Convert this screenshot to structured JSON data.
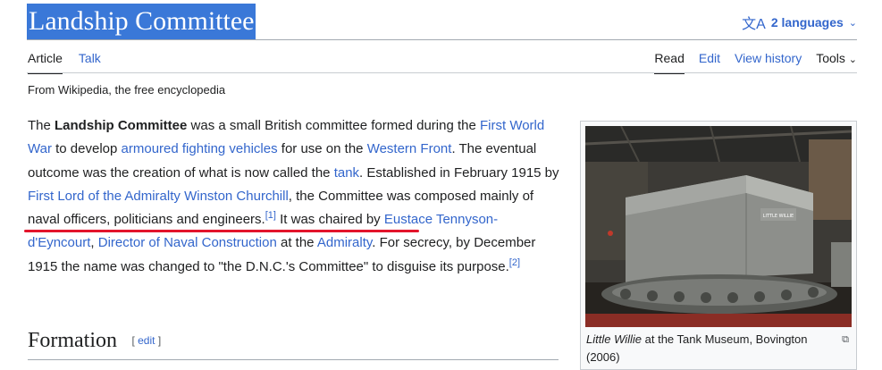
{
  "page": {
    "title": "Landship Committee",
    "languages": "2 languages",
    "tagline": "From Wikipedia, the free encyclopedia"
  },
  "tabs": {
    "article": "Article",
    "talk": "Talk",
    "read": "Read",
    "edit": "Edit",
    "history": "View history",
    "tools": "Tools"
  },
  "body": {
    "t1": "The ",
    "bold": "Landship Committee",
    "t2": " was a small British committee formed during the ",
    "l_ww1": "First World War",
    "t3": " to develop ",
    "l_afv": "armoured fighting vehicles",
    "t4": " for use on the ",
    "l_wf": "Western Front",
    "t5": ". The eventual outcome was the creation of what is now called the ",
    "l_tank": "tank",
    "t6": ". Established in February 1915 by ",
    "l_fla": "First Lord of the Admiralty",
    "t7": " ",
    "l_wc": "Winston Churchill",
    "t8": ", the Committee was composed mainly of naval officers, politicians and engineers.",
    "ref1": "[1]",
    "t9": " It was chaired by ",
    "l_etd": "Eustace Tennyson-d'Eyncourt",
    "t10": ", ",
    "l_dnc": "Director of Naval Construction",
    "t11": " at the ",
    "l_adm": "Admiralty",
    "t12": ". For secrecy, by December 1915 the name was changed to \"the D.N.C.'s Committee\" to disguise its purpose.",
    "ref2": "[2]"
  },
  "section": {
    "title": "Formation",
    "edit_open": "[ ",
    "edit_label": "edit",
    "edit_close": " ]"
  },
  "infobox": {
    "caption_italic": "Little Willie",
    "caption_rest": " at the Tank Museum, Bovington (2006)",
    "image_label": "LITTLE WILLIE",
    "enlarge_icon": "enlarge-icon"
  },
  "colors": {
    "link": "#3366cc",
    "title_highlight": "#3a78d8",
    "annotation_underline": "#e3142b"
  }
}
